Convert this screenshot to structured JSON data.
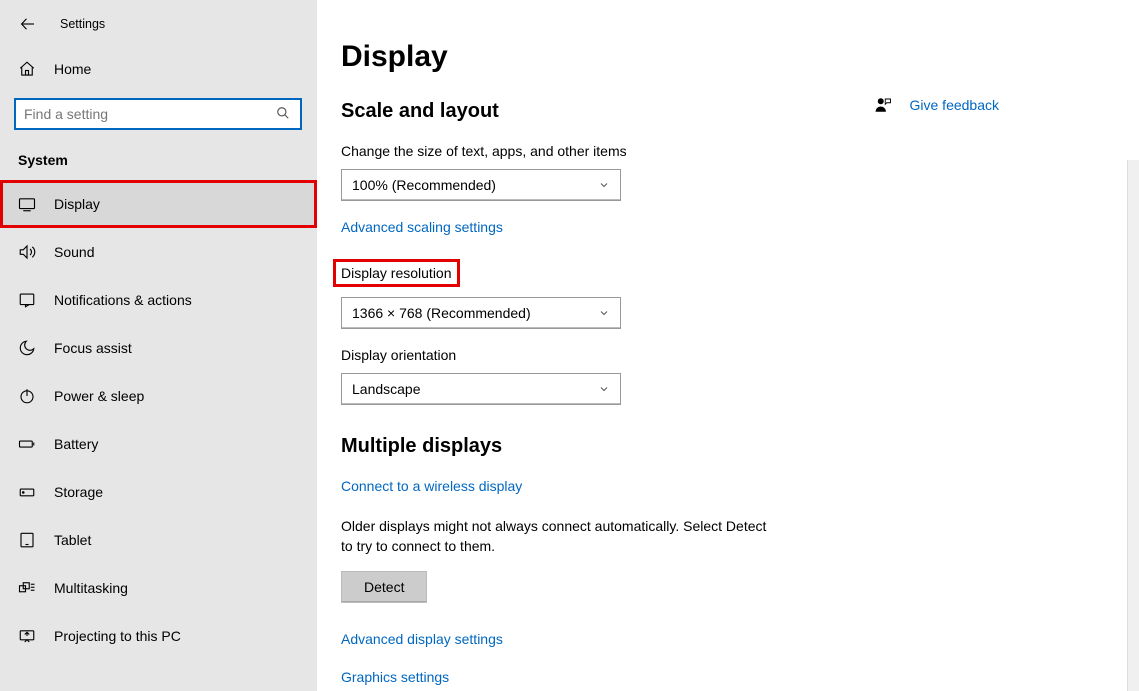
{
  "window": {
    "title": "Settings"
  },
  "sidebar": {
    "home": "Home",
    "search_placeholder": "Find a setting",
    "group": "System",
    "items": [
      {
        "label": "Display"
      },
      {
        "label": "Sound"
      },
      {
        "label": "Notifications & actions"
      },
      {
        "label": "Focus assist"
      },
      {
        "label": "Power & sleep"
      },
      {
        "label": "Battery"
      },
      {
        "label": "Storage"
      },
      {
        "label": "Tablet"
      },
      {
        "label": "Multitasking"
      },
      {
        "label": "Projecting to this PC"
      }
    ]
  },
  "feedback": {
    "label": "Give feedback"
  },
  "main": {
    "title": "Display",
    "scale_section": "Scale and layout",
    "scale_label": "Change the size of text, apps, and other items",
    "scale_value": "100% (Recommended)",
    "adv_scaling": "Advanced scaling settings",
    "res_label": "Display resolution",
    "res_value": "1366 × 768 (Recommended)",
    "orient_label": "Display orientation",
    "orient_value": "Landscape",
    "multi_section": "Multiple displays",
    "wireless_link": "Connect to a wireless display",
    "detect_helper": "Older displays might not always connect automatically. Select Detect to try to connect to them.",
    "detect_btn": "Detect",
    "adv_display": "Advanced display settings",
    "graphics": "Graphics settings"
  }
}
